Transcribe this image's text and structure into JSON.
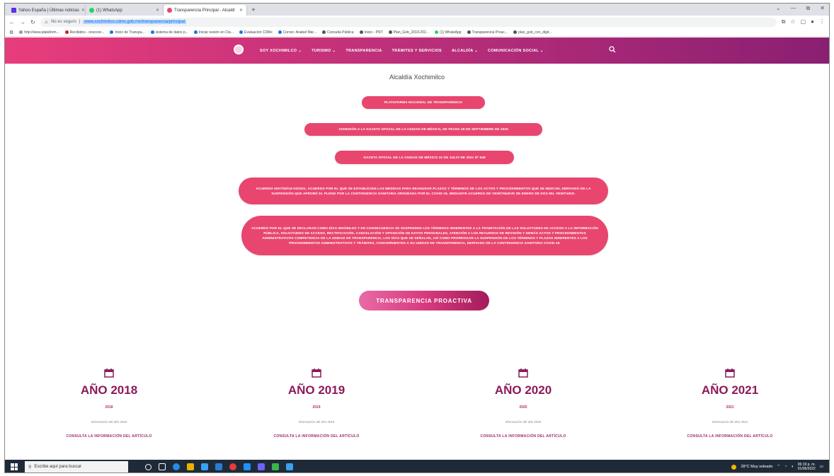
{
  "browser": {
    "tabs": [
      {
        "label": "Yahoo España | Últimas noticias",
        "color": "#5f2eea"
      },
      {
        "label": "(1) WhatsApp",
        "color": "#25d366"
      },
      {
        "label": "Transparencia Principal - Alcaldí",
        "color": "#e8466f"
      }
    ],
    "new_tab": "+",
    "window_controls": [
      "⌄",
      "—",
      "⧉",
      "✕"
    ],
    "security_label": "No es seguro",
    "url": "www.xochimilco.cdmx.gob.mx/transparencia/principal",
    "bookmarks": [
      {
        "label": "http://www.plataform...",
        "color": "#999999"
      },
      {
        "label": "Recibidos - onecore...",
        "color": "#c5221f"
      },
      {
        "label": "Inicio de Transpa...",
        "color": "#1a73e8"
      },
      {
        "label": "sistema de datos p...",
        "color": "#1a73e8"
      },
      {
        "label": "Iniciar sesión en Cla...",
        "color": "#1a73e8"
      },
      {
        "label": "Evaluación CDMx",
        "color": "#1a73e8"
      },
      {
        "label": "Correo: Anabel Mar...",
        "color": "#1a73e8"
      },
      {
        "label": "Consulta Pública",
        "color": "#555555"
      },
      {
        "label": "Inicio - PNT",
        "color": "#555555"
      },
      {
        "label": "Plan_Gob_2019-202...",
        "color": "#555555"
      },
      {
        "label": "(1) WhatsApp",
        "color": "#25d366"
      },
      {
        "label": "Transparencia Proac...",
        "color": "#555555"
      },
      {
        "label": "plan_gob_con_digit...",
        "color": "#555555"
      }
    ]
  },
  "nav": {
    "items": [
      "SOY XOCHIMILCO ⌄",
      "TURISMO ⌄",
      "TRANSPARENCIA",
      "TRÁMITES Y SERVICIOS",
      "ALCALDÍA ⌄",
      "COMUNICACIÓN SOCIAL ⌄"
    ],
    "accent": "#c0307a"
  },
  "page": {
    "heading": "Alcaldía Xochimilco",
    "buttons": [
      "PLATAFORMA NACIONAL DE TRANSPARENCIA",
      "ADHESIÓN A LA GACETA OFICIAL DE LA CIUDAD DE MÉXICO, DE FECHA 28 DE SEPTIEMBRE DE 2020",
      "GACETA OFICIAL DE LA CIUDAD DE MÉXICO 22 DE JULIO DE 2021 Nº 648",
      "ACUERDO 0007/SE/19-03/2021, ACUERDO POR EL QUE SE ESTABLECEN LAS MEDIDAS PARA REANUDAR PLAZOS Y TÉRMINOS DE LOS ACTOS Y PROCEDIMIENTOS QUE SE INDICAN, DERIVADO DE LA SUSPENSIÓN QUE APROBÓ EL PLENO POR LA CONTINGENCIA SANITARIA ORIGINADA POR EL COVID-19, MEDIANTE ACUERDO DE VEINTINUEVE DE ENERO DE DOS MIL VEINTIUNO.",
      "ACUERDO POR EL QUE SE DECLARAN COMO DÍAS INHÁBILES Y EN CONSECUENCIA SE SUSPENDEN LOS TÉRMINOS INHERENTES A LA TRAMITACIÓN DE LAS SOLICITUDES DE ACCESO A LA INFORMACIÓN PÚBLICA, SOLICITUDES DE ACCESO, RECTIFICACIÓN, CANCELACIÓN Y OPOSICIÓN DE DATOS PERSONALES, ATENCIÓN A LOS RECURSOS DE REVISIÓN Y DEMÁS ACTOS Y PROCEDIMIENTOS ADMINISTRATIVOS COMPETENCIA DE LA UNIDAD DE TRANSPARENCIA, LOS DÍAS QUE SE SEÑALAN, ASÍ COMO PRORROGAR LA SUSPENSIÓN DE LOS TÉRMINOS Y PLAZOS INHERENTES A LOS PROCEDIMIENTOS ADMINISTRATIVOS Y TRÁMITES, CONCERNIENTES A SU UNIDAD DE TRANSPARENCIA, DERIVADO DE LA CONTINGENCIA SANITARIA COVID-19."
    ],
    "proactive": "TRANSPARENCIA PROACTIVA",
    "years": [
      {
        "title": "AÑO 2018",
        "sub": "2018",
        "desc": "Información del año 2018",
        "link": "CONSULTA LA INFORMACIÓN DEL ARTÍCULO"
      },
      {
        "title": "AÑO 2019",
        "sub": "2019",
        "desc": "Información del año 2019",
        "link": "CONSULTA LA INFORMACIÓN DEL ARTÍCULO"
      },
      {
        "title": "AÑO 2020",
        "sub": "2020",
        "desc": "Información del año 2020",
        "link": "CONSULTA LA INFORMACIÓN DEL ARTÍCULO"
      },
      {
        "title": "AÑO 2021",
        "sub": "2021",
        "desc": "Información del año 2021",
        "link": "CONSULTA LA INFORMACIÓN DEL ARTÍCULO"
      }
    ]
  },
  "taskbar": {
    "search_placeholder": "Escribe aquí para buscar",
    "app_colors": [
      "#ffffff",
      "#ffffff",
      "#2a8ae0",
      "#e8b400",
      "#3aa0f0",
      "#2b7cd3",
      "#e23d3d",
      "#1e90ff",
      "#6c63ff",
      "#3ab54a",
      "#3aa0f0"
    ],
    "weather": "28°C  Muy soleado",
    "time": "06:19 p. m.",
    "date": "01/06/2022"
  }
}
